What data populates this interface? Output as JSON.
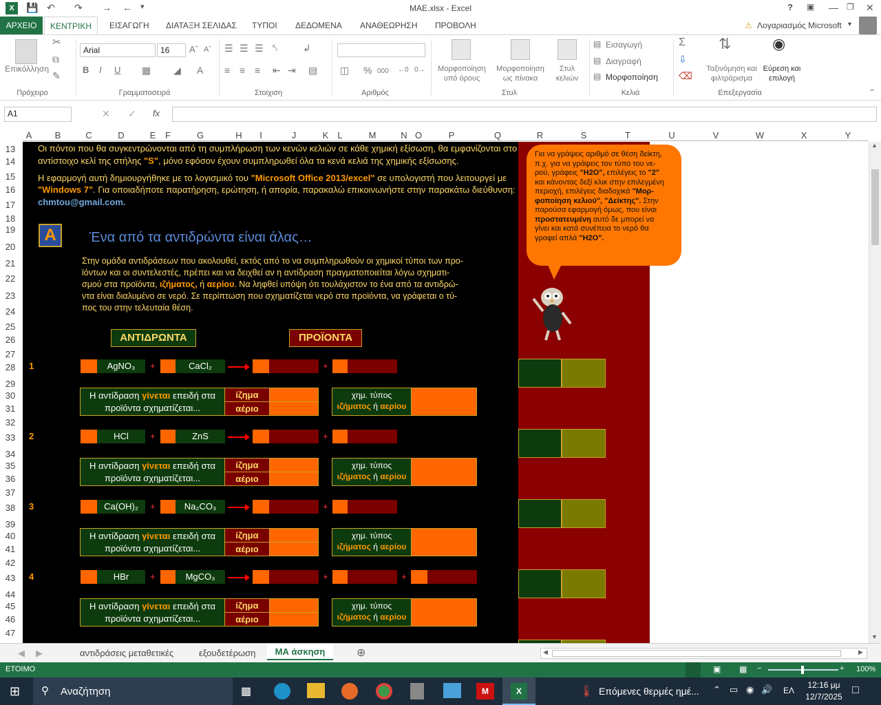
{
  "window": {
    "title": "MAE.xlsx - Excel",
    "help": "?"
  },
  "ribbon_tabs": [
    "ΑΡΧΕΙΟ",
    "ΚΕΝΤΡΙΚΗ",
    "ΕΙΣΑΓΩΓΗ",
    "ΔΙΑΤΑΞΗ ΣΕΛΙΔΑΣ",
    "ΤΥΠΟΙ",
    "ΔΕΔΟΜΕΝΑ",
    "ΑΝΑΘΕΩΡΗΣΗ",
    "ΠΡΟΒΟΛΗ"
  ],
  "account": "Λογαριασμός Microsoft",
  "ribbon": {
    "paste": "Επικόλληση",
    "font_name": "Arial",
    "font_size": "16",
    "cond_format": [
      "Μορφοποίηση",
      "υπό όρους"
    ],
    "format_table": [
      "Μορφοποίηση",
      "ως πίνακα"
    ],
    "cell_styles": [
      "Στυλ",
      "κελιών"
    ],
    "insert": "Εισαγωγή",
    "delete": "Διαγραφή",
    "format": "Μορφοποίηση",
    "sort": [
      "Ταξινόμηση και",
      "φιλτράρισμα"
    ],
    "find": [
      "Εύρεση και",
      "επιλογή"
    ],
    "groups": [
      "Πρόχειρο",
      "Γραμματοσειρά",
      "Στοίχιση",
      "Αριθμός",
      "Στυλ",
      "Κελιά",
      "Επεξεργασία"
    ],
    "percent": "%",
    "thousands": "000"
  },
  "namebox": "A1",
  "fx": "fx",
  "columns": [
    "A",
    "B",
    "C",
    "D",
    "E",
    "F",
    "G",
    "H",
    "I",
    "J",
    "K",
    "L",
    "M",
    "N",
    "O",
    "P",
    "Q",
    "R",
    "S",
    "T",
    "U",
    "V",
    "W",
    "X",
    "Y"
  ],
  "rows": [
    "13",
    "14",
    "15",
    "16",
    "17",
    "18",
    "19",
    "20",
    "21",
    "22",
    "23",
    "24",
    "25",
    "26",
    "27",
    "28",
    "29",
    "30",
    "31",
    "32",
    "33",
    "34",
    "35",
    "36",
    "37",
    "38",
    "39",
    "40",
    "41",
    "42",
    "43",
    "44",
    "45",
    "46",
    "47"
  ],
  "sheet": {
    "intro1a": "Οι πόντοι που θα συγκεντρώνονται από τη συμπλήρωση των κενών κελιών σε κάθε χημική εξίσωση, θα εμφανίζονται στο",
    "intro1b_pre": "αντίστοιχο κελί της στήλης ",
    "intro1b_hl": "\"S\"",
    "intro1b_post": ", μόνο εφόσον έχουν συμπληρωθεί όλα τα κενά κελιά της χημικής εξίσωσης.",
    "intro2a_pre": "Η εφαρμογή αυτή δημιουργήθηκε με το λογισμικό του ",
    "intro2a_hl": "\"Microsoft Office 2013/excel\"",
    "intro2a_post": " σε υπολογιστή που λειτουργεί με",
    "intro2b_hl": "\"Windows 7\"",
    "intro2b_post": ". Για οποιαδήποτε παρατήρηση, ερώτηση, ή απορία, παρακαλώ επικοινωνήστε στην παρακάτω διεύθυνση:",
    "email": "chmtou@gmail.com.",
    "section_letter": "A",
    "section_title": "Ένα από τα αντιδρώντα είναι άλας…",
    "desc1": "Στην ομάδα αντιδράσεων που ακολουθεί, εκτός από το να συμπληρωθούν οι χημικοί τύποι των προ-",
    "desc2": "ϊόντων και οι συντελεστές, πρέπει και να δειχθεί αν η αντίδραση πραγματοποιείται λόγω σχηματι-",
    "desc3_pre": "σμού στα προϊόντα, ",
    "desc3_hl1": "ιζήματος,",
    "desc3_mid": " ή ",
    "desc3_hl2": "αερίου",
    "desc3_post": ". Να ληφθεί υπόψη ότι τουλάχιστον το ένα από τα αντιδρώ-",
    "desc4": "ντα είναι διαλυμένο σε νερό. Σε περίπτωση που σχηματίζεται νερό στα προϊόντα, να γράφεται ο τύ-",
    "desc5": "πος του στην τελευταία θέση.",
    "reactants_header": "ΑΝΤΙΔΡΩΝΤΑ",
    "products_header": "ΠΡΟΪΟΝΤΑ",
    "plus": "+",
    "reaction_text1_pre": "Η αντίδραση ",
    "reaction_text1_hl": "γίνεται",
    "reaction_text1_post": " επειδή στα",
    "reaction_text2": "προϊόντα σχηματίζεται...",
    "precipitate": "ίζημα",
    "gas": "αέριο",
    "chem_type": "χημ. τύπος",
    "chem_of_pre": "ιζήματος",
    "chem_of_mid": " ή ",
    "chem_of_post": "αερίου",
    "reactions": [
      {
        "num": "1",
        "r1": "AgNO₃",
        "r2": "CaCl₂"
      },
      {
        "num": "2",
        "r1": "HCl",
        "r2": "ZnS"
      },
      {
        "num": "3",
        "r1": "Ca(OH)₂",
        "r2": "Na₂CO₃"
      },
      {
        "num": "4",
        "r1": "HBr",
        "r2": "MgCO₃"
      }
    ]
  },
  "bubble": {
    "l1": "Για να γράψεις αριθμό σε θέση δείκτη,",
    "l2": "π.χ. για να γράψεις τον τύπο του νε-",
    "l3_pre": "ρού, γράφεις ",
    "l3_hl": "\"H2O\",",
    "l3_post": " επιλέγεις το ",
    "l3_hl2": "\"2\"",
    "l4": "και κάνοντας δεξί κλικ στην επιλεγμένη",
    "l5_pre": "περιοχή, επιλέγεις διαδοχικά ",
    "l5_hl": "\"Μορ-",
    "l6_hl": "φοποίηση κελιού\", \"Δείκτης\".",
    "l6_post": " Στην",
    "l7": "παρούσα εφαρμογή όμως, που είναι",
    "l8_hl": "προστατευμένη",
    "l8_post": " αυτό δε μπορεί να",
    "l9": "γίνει και κατά συνέπεια το νερό θα",
    "l10_pre": "γραφεί απλά ",
    "l10_hl": "\"H2O\"."
  },
  "sheet_tabs": [
    "αντιδράσεις μεταθετικές",
    "εξουδετέρωση",
    "ΜΑ άσκηση"
  ],
  "status": {
    "ready": "ΕΤΟΙΜΟ",
    "zoom": "100%"
  },
  "taskbar": {
    "search": "Αναζήτηση",
    "weather": "Επόμενες θερμές ημέ...",
    "lang": "ΕΛ",
    "time": "12:16 μμ",
    "date": "12/7/2025"
  },
  "colors": {
    "excel_green": "#217346",
    "sheet_bg": "#000000",
    "orange": "#ff6600",
    "dark_red": "#7a0000",
    "dark_green": "#0d3b0d"
  }
}
